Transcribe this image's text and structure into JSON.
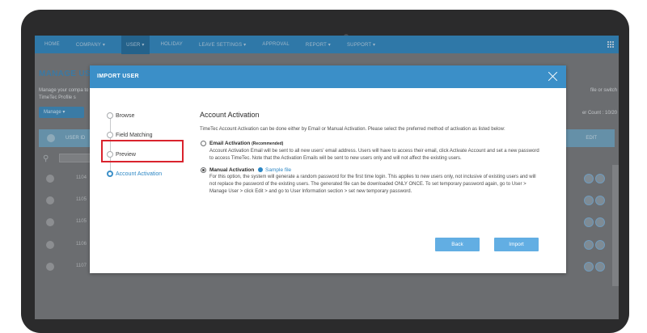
{
  "topnav": {
    "items": [
      "HOME",
      "COMPANY ▾",
      "USER ▾",
      "HOLIDAY",
      "LEAVE SETTINGS ▾",
      "APPROVAL",
      "REPORT ▾",
      "SUPPORT ▾"
    ]
  },
  "background": {
    "page_title": "MANAGE USE",
    "intro_text": "Manage your compa to TimeTec Profile s",
    "right_text": "file or switch",
    "manage_button": "Manage ▾",
    "user_count": "er Count : 10/20",
    "column_user_id": "USER ID",
    "column_edit": "EDIT",
    "rows": [
      "1104",
      "1105",
      "1105",
      "1106",
      "1107"
    ]
  },
  "modal": {
    "title": "IMPORT USER",
    "steps": [
      "Browse",
      "Field Matching",
      "Preview",
      "Account Activation"
    ],
    "active_step": "Account Activation",
    "section_title": "Account Activation",
    "intro": "TimeTec Account Activation can be done either by Email or Manual Activation. Please select the preferred method of activation as listed below:",
    "email_option": {
      "title": "Email Activation",
      "note": "(Recommended)",
      "description": "Account Activation Email will be sent to all new users' email address. Users will have to access their email, click Activate Account and set a new password to access TimeTec. Note that the Activation Emails will be sent to new users only and will not affect the existing users."
    },
    "manual_option": {
      "title": "Manual Activation",
      "sample_link": "Sample file",
      "description": "For this option, the system will generate a random password for the first time login. This applies to new users only, not inclusive of existing users and will not replace the password of the existing users. The generated file can be downloaded ONLY ONCE. To set temporary password again, go to User > Manage User > click Edit > and go to User Information section > set new temporary password."
    },
    "back_label": "Back",
    "import_label": "Import"
  },
  "colors": {
    "header_blue": "#3b8fc8",
    "button_blue": "#62aee3",
    "highlight_red": "#d9232d"
  }
}
